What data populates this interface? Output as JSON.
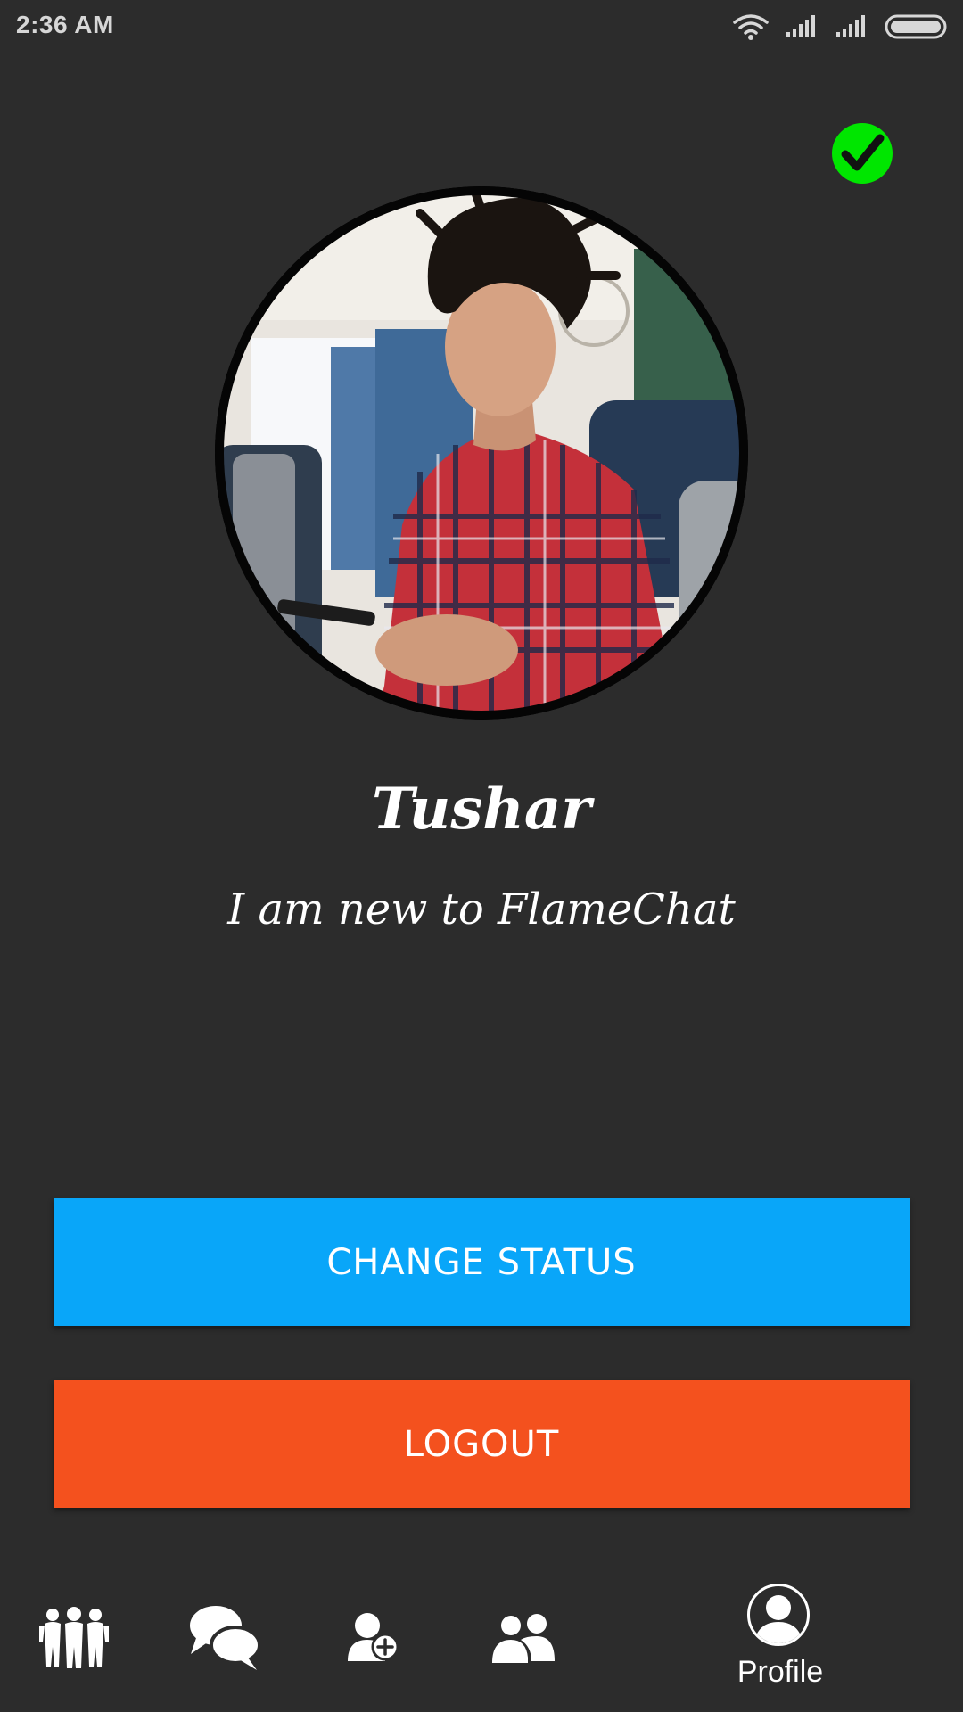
{
  "status_bar": {
    "time": "2:36 AM",
    "icons": [
      "wifi-icon",
      "signal-icon",
      "signal-icon",
      "battery-icon"
    ]
  },
  "profile": {
    "verified_icon": "check-circle-icon",
    "name": "Tushar",
    "status": "I am new to FlameChat"
  },
  "actions": {
    "change_status_label": "CHANGE STATUS",
    "logout_label": "LOGOUT"
  },
  "bottom_nav": {
    "items": [
      {
        "icon": "groups-icon"
      },
      {
        "icon": "chats-icon"
      },
      {
        "icon": "add-friend-icon"
      },
      {
        "icon": "friends-icon"
      },
      {
        "icon": "profile-icon",
        "label": "Profile",
        "selected": true
      }
    ]
  },
  "colors": {
    "background": "#2c2c2c",
    "change_status": "#09a6f9",
    "logout": "#f4511e",
    "verified": "#00e600"
  }
}
